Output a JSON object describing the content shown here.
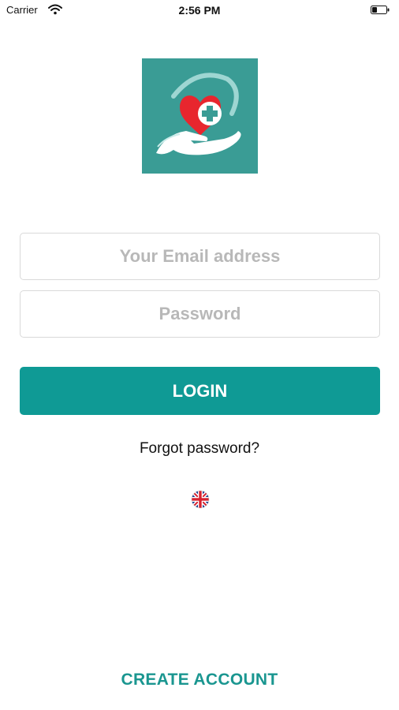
{
  "status_bar": {
    "carrier": "Carrier",
    "time": "2:56 PM",
    "wifi_icon": "wifi-icon",
    "battery_icon": "battery-icon"
  },
  "logo": {
    "icon": "heart-hand-medical-logo",
    "background_color": "#3a9c95",
    "heart_color": "#e8262e"
  },
  "login_form": {
    "email_placeholder": "Your Email address",
    "email_value": "",
    "password_placeholder": "Password",
    "password_value": "",
    "login_label": "LOGIN",
    "forgot_label": "Forgot password?"
  },
  "language": {
    "icon": "uk-flag-icon"
  },
  "footer": {
    "create_account_label": "CREATE ACCOUNT"
  },
  "colors": {
    "accent": "#0f9a95",
    "link_accent": "#1a9690",
    "placeholder": "#b8b8b8",
    "border": "#d9d9d9"
  }
}
